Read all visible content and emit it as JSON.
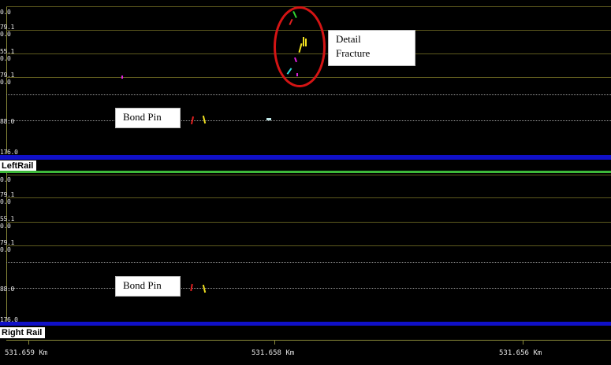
{
  "left_panel": {
    "rail_label": "LeftRail",
    "y_labels": [
      "0.0",
      "79.1",
      "0.0",
      "55.1",
      "0.0",
      "79.1",
      "0.0",
      "88.0",
      "176.0"
    ],
    "callouts": {
      "detail_fracture": "Detail\nFracture",
      "bond_pin": "Bond Pin"
    }
  },
  "right_panel": {
    "rail_label": "Right Rail",
    "y_labels": [
      "0.0",
      "79.1",
      "0.0",
      "55.1",
      "0.0",
      "79.1",
      "0.0",
      "88.0",
      "176.0"
    ],
    "callouts": {
      "bond_pin": "Bond Pin"
    }
  },
  "x_axis": {
    "labels": [
      "531.659 Km",
      "531.658 Km",
      "531.656 Km"
    ]
  },
  "colors": {
    "background": "#000000",
    "rail_bar": "#1010c8",
    "separator": "#3eb83a",
    "highlight_circle": "#d41414",
    "echo_red": "#e02020",
    "echo_yellow": "#f0e020",
    "echo_green": "#30d030",
    "echo_magenta": "#e020e0",
    "echo_cyan": "#30e0e0"
  }
}
